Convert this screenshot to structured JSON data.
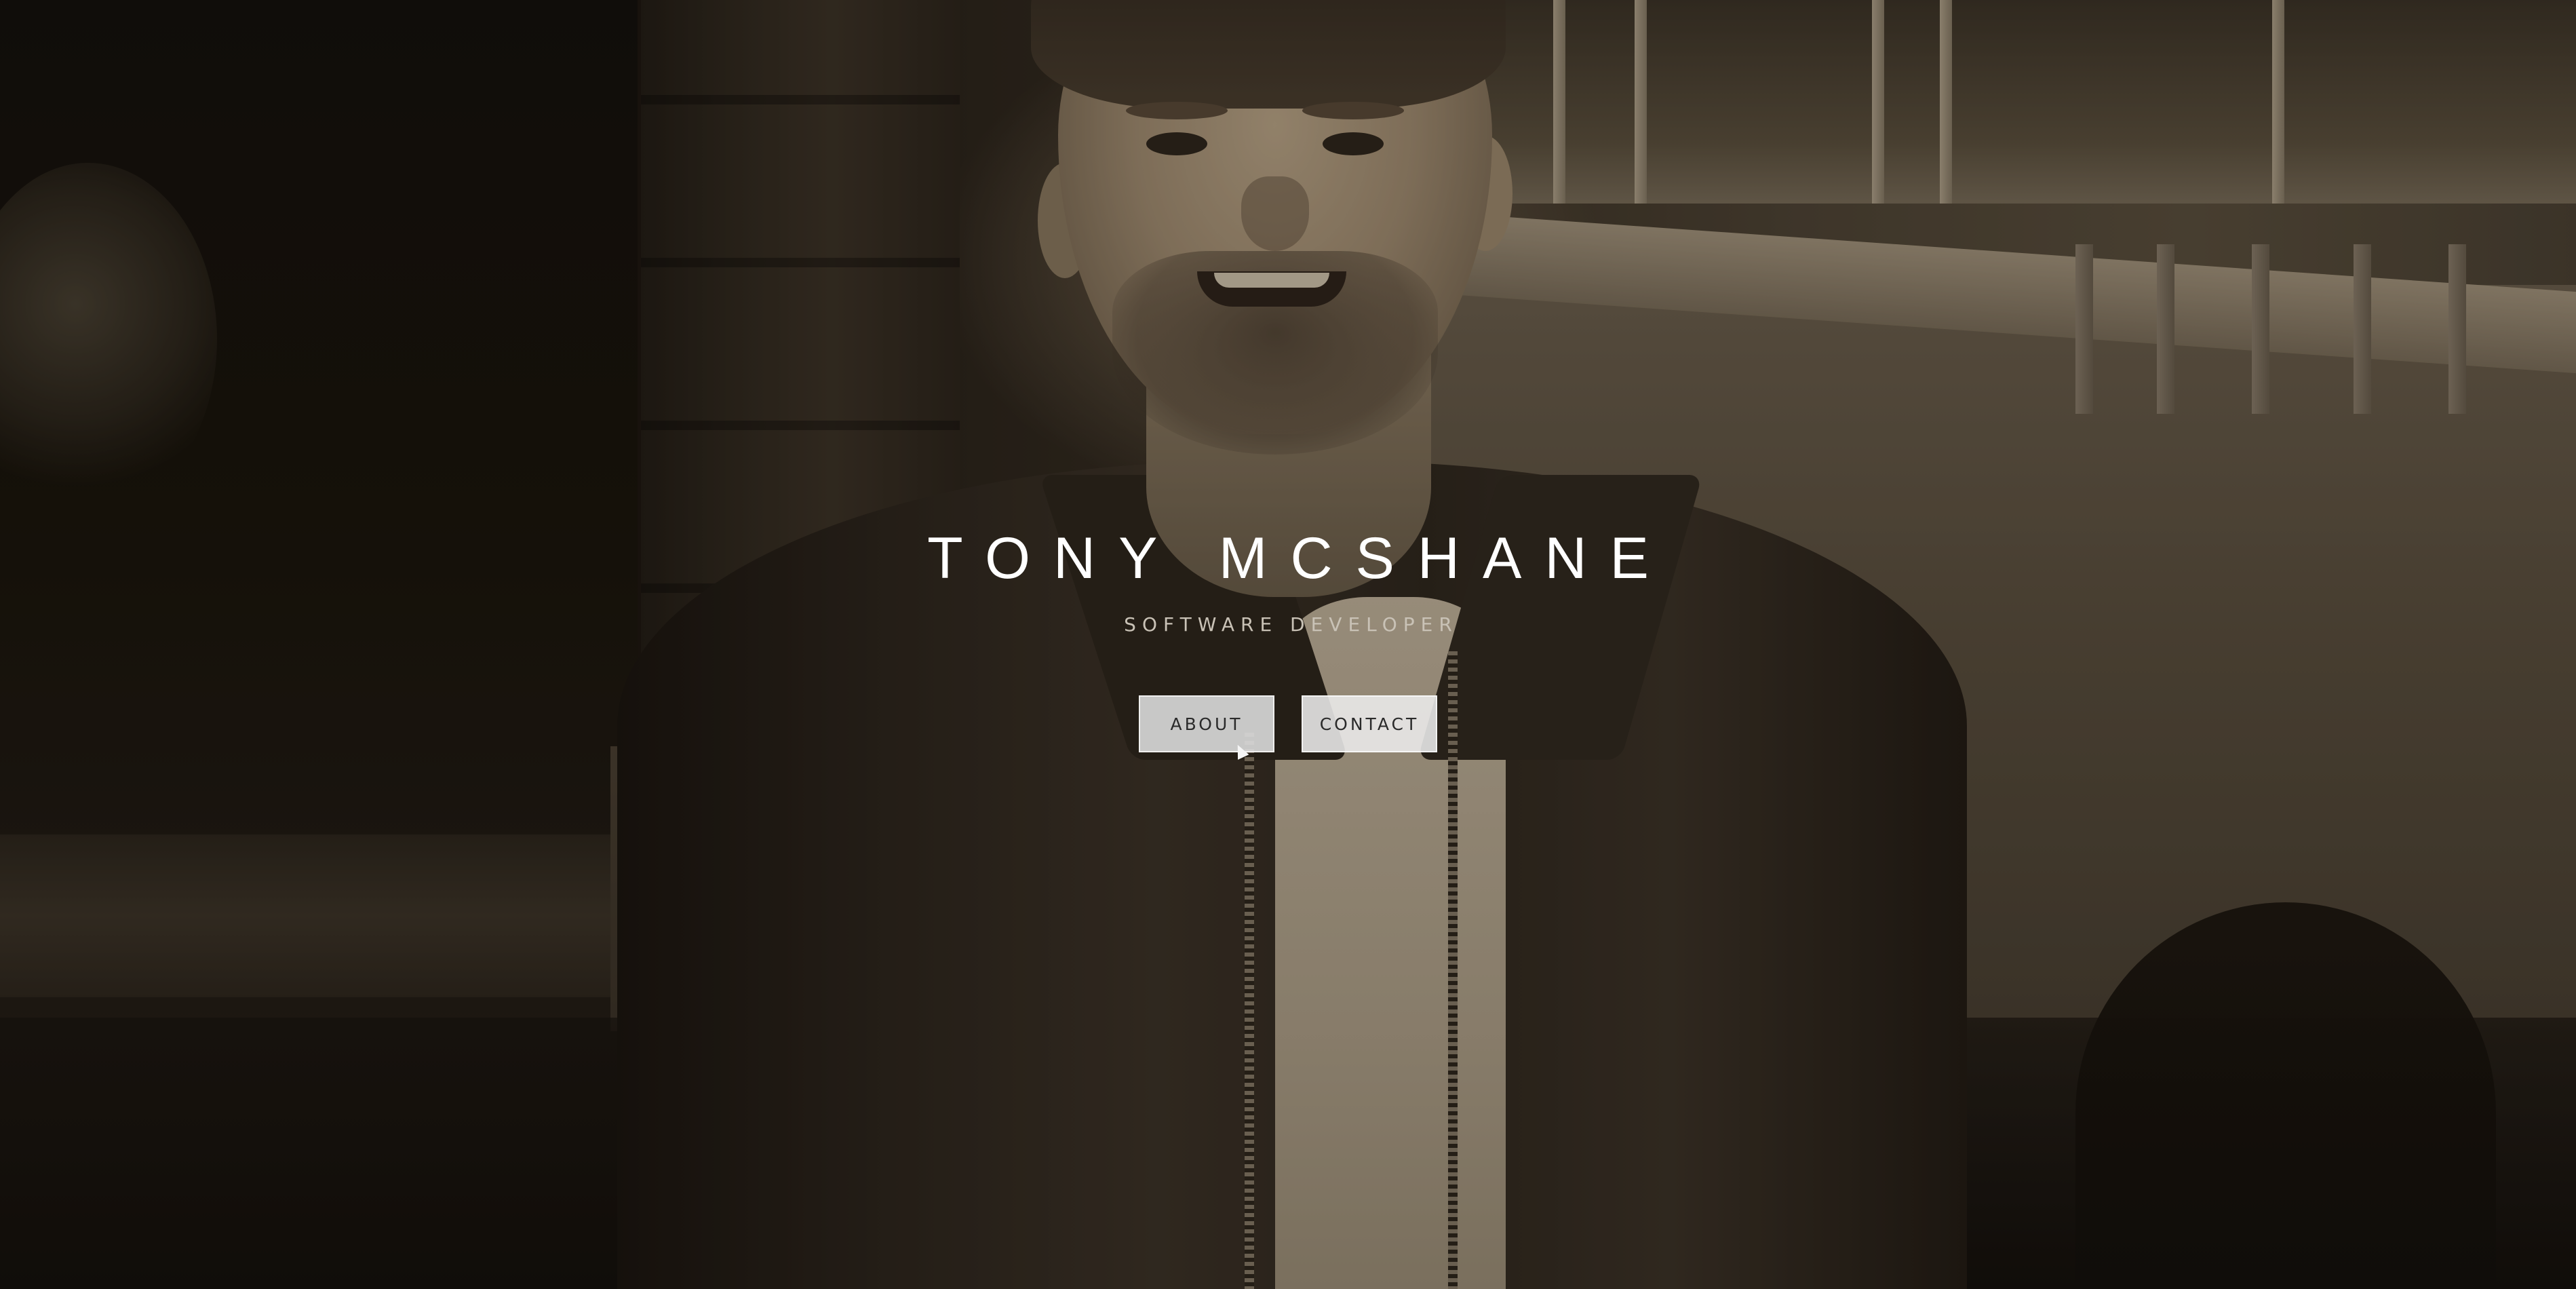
{
  "hero": {
    "name": "TONY MCSHANE",
    "role": "SOFTWARE DEVELOPER"
  },
  "buttons": {
    "about_label": "ABOUT",
    "contact_label": "CONTACT"
  },
  "colors": {
    "title_text": "#ffffff",
    "subtitle_text": "#c9c2b6",
    "button_bg": "#ececec",
    "button_text": "#2a2a2a",
    "photo_tint": "sepia"
  },
  "icons": {
    "cursor": "mouse-pointer-icon"
  }
}
